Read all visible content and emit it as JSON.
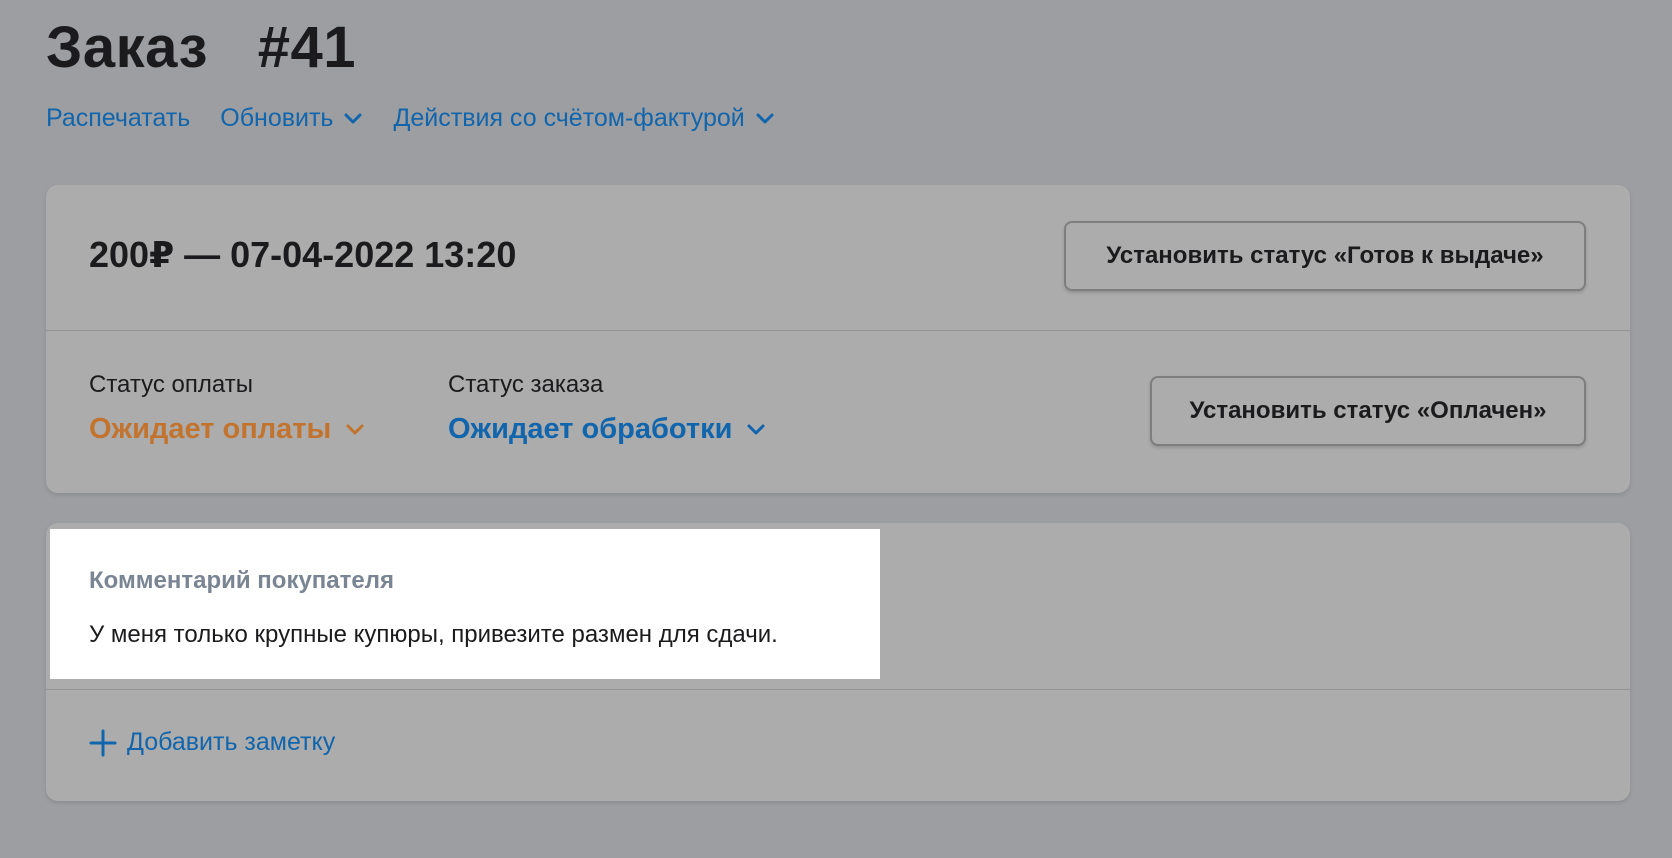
{
  "page": {
    "title": "Заказ   #41"
  },
  "actions": {
    "print_label": "Распечатать",
    "update_label": "Обновить",
    "invoice_label": "Действия со счётом-фактурой"
  },
  "order": {
    "summary": "200₽ — 07-04-2022 13:20",
    "set_ready_label": "Установить статус «Готов к выдаче»",
    "payment_status_label": "Статус оплаты",
    "payment_status_value": "Ожидает оплаты",
    "order_status_label": "Статус заказа",
    "order_status_value": "Ожидает обработки",
    "set_paid_label": "Установить статус «Оплачен»"
  },
  "comment": {
    "title": "Комментарий покупателя",
    "text": "У меня только крупные купюры, привезите размен для сдачи."
  },
  "notes": {
    "add_label": "Добавить заметку"
  },
  "colors": {
    "link": "#1065ad",
    "payment_pending": "#c2742f",
    "overlay_background": "#9d9ea1",
    "highlight": "#ffffff"
  },
  "icons": {
    "dropdown": "chevron-down-icon",
    "add": "plus-icon"
  }
}
